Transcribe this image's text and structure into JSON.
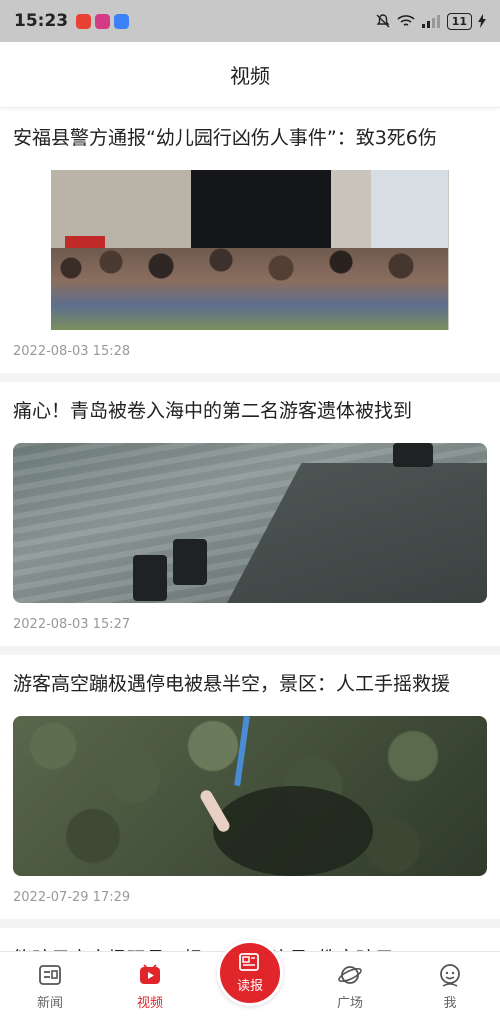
{
  "status_bar": {
    "time": "15:23",
    "battery": "11",
    "app_colors": [
      "#e94235",
      "#d43c86",
      "#3b82f6"
    ]
  },
  "header": {
    "title": "视频"
  },
  "feed": [
    {
      "title": "安福县警方通报“幼儿园行凶伤人事件”：致3死6伤",
      "time": "2022-08-03 15:28"
    },
    {
      "title": "痛心！青岛被卷入海中的第二名游客遗体被找到",
      "time": "2022-08-03 15:27"
    },
    {
      "title": "游客高空蹦极遇停电被悬半空，景区：人工手摇救援",
      "time": "2022-07-29 17:29"
    },
    {
      "title": "能孩子高空场玩具，妈：“专业演员”教育孩子"
    }
  ],
  "bottom_nav": {
    "items": [
      {
        "label": "新闻",
        "icon": "news-icon"
      },
      {
        "label": "视频",
        "icon": "video-icon"
      },
      {
        "label": "读报",
        "icon": "newspaper-icon"
      },
      {
        "label": "广场",
        "icon": "planet-icon"
      },
      {
        "label": "我",
        "icon": "profile-icon"
      }
    ],
    "active": "视频",
    "accent": "#e0262b"
  }
}
